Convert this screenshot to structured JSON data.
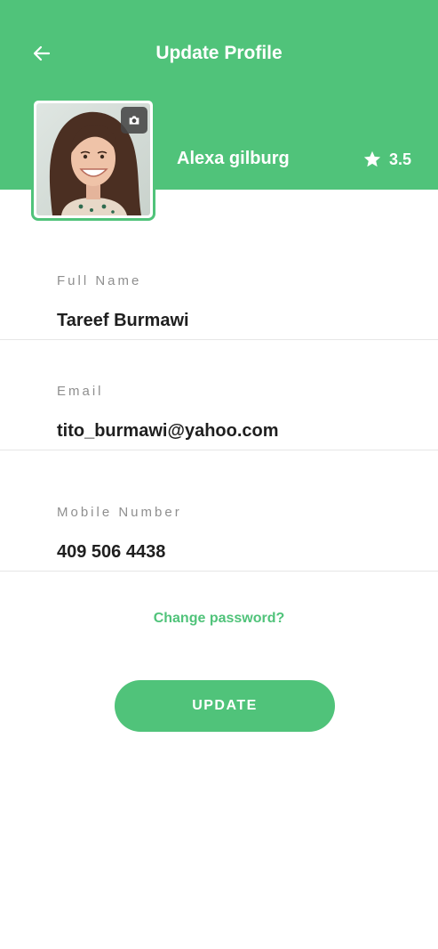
{
  "header": {
    "title": "Update Profile",
    "back_icon": "arrow-left-icon",
    "camera_icon": "camera-icon",
    "rating_icon": "star-icon",
    "user_name": "Alexa gilburg",
    "rating": "3.5"
  },
  "form": {
    "full_name": {
      "label": "Full Name",
      "value": "Tareef Burmawi"
    },
    "email": {
      "label": "Email",
      "value": "tito_burmawi@yahoo.com"
    },
    "mobile": {
      "label": "Mobile Number",
      "value": "409 506 4438"
    }
  },
  "change_password_label": "Change password?",
  "update_button_label": "UPDATE",
  "colors": {
    "accent": "#50c37a",
    "background": "#ffffff",
    "label_text": "#8f8f8f",
    "value_text": "#1f1f1f"
  }
}
